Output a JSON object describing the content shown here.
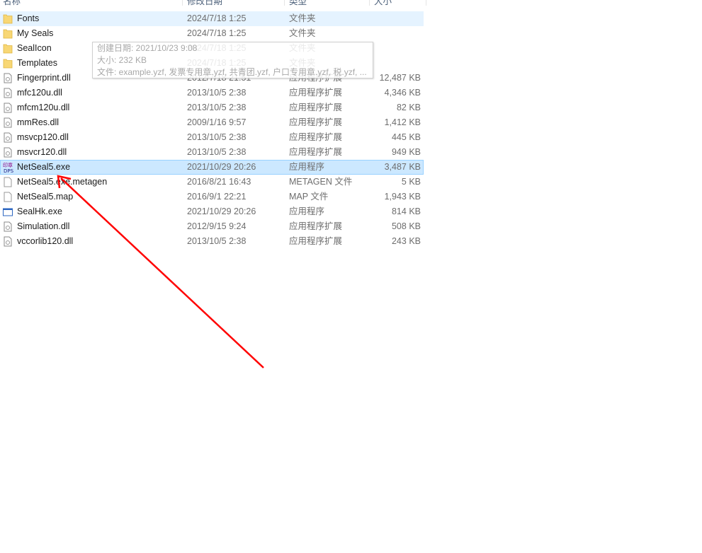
{
  "columns": {
    "name": "名称",
    "date": "修改日期",
    "type": "类型",
    "size": "大小"
  },
  "files": [
    {
      "name": "Fonts",
      "date": "2024/7/18 1:25",
      "type": "文件夹",
      "size": "",
      "icon": "folder-icon",
      "state": "hover"
    },
    {
      "name": "My Seals",
      "date": "2024/7/18 1:25",
      "type": "文件夹",
      "size": "",
      "icon": "folder-icon"
    },
    {
      "name": "SealIcon",
      "date": "2024/7/18 1:25",
      "type": "文件夹",
      "size": "",
      "icon": "folder-icon"
    },
    {
      "name": "Templates",
      "date": "2024/7/18 1:25",
      "type": "文件夹",
      "size": "",
      "icon": "folder-icon"
    },
    {
      "name": "Fingerprint.dll",
      "date": "2012/7/18 21:51",
      "type": "应用程序扩展",
      "size": "12,487 KB",
      "icon": "dll-icon"
    },
    {
      "name": "mfc120u.dll",
      "date": "2013/10/5 2:38",
      "type": "应用程序扩展",
      "size": "4,346 KB",
      "icon": "dll-icon"
    },
    {
      "name": "mfcm120u.dll",
      "date": "2013/10/5 2:38",
      "type": "应用程序扩展",
      "size": "82 KB",
      "icon": "dll-icon"
    },
    {
      "name": "mmRes.dll",
      "date": "2009/1/16 9:57",
      "type": "应用程序扩展",
      "size": "1,412 KB",
      "icon": "dll-icon"
    },
    {
      "name": "msvcp120.dll",
      "date": "2013/10/5 2:38",
      "type": "应用程序扩展",
      "size": "445 KB",
      "icon": "dll-icon"
    },
    {
      "name": "msvcr120.dll",
      "date": "2013/10/5 2:38",
      "type": "应用程序扩展",
      "size": "949 KB",
      "icon": "dll-icon"
    },
    {
      "name": "NetSeal5.exe",
      "date": "2021/10/29 20:26",
      "type": "应用程序",
      "size": "3,487 KB",
      "icon": "netseal-app-icon",
      "state": "selected"
    },
    {
      "name": "NetSeal5.exe.metagen",
      "date": "2016/8/21 16:43",
      "type": "METAGEN 文件",
      "size": "5 KB",
      "icon": "file-icon"
    },
    {
      "name": "NetSeal5.map",
      "date": "2016/9/1 22:21",
      "type": "MAP 文件",
      "size": "1,943 KB",
      "icon": "file-icon"
    },
    {
      "name": "SealHk.exe",
      "date": "2021/10/29 20:26",
      "type": "应用程序",
      "size": "814 KB",
      "icon": "exe-window-icon"
    },
    {
      "name": "Simulation.dll",
      "date": "2012/9/15 9:24",
      "type": "应用程序扩展",
      "size": "508 KB",
      "icon": "dll-icon"
    },
    {
      "name": "vccorlib120.dll",
      "date": "2013/10/5 2:38",
      "type": "应用程序扩展",
      "size": "243 KB",
      "icon": "dll-icon"
    }
  ],
  "tooltip": {
    "created": "创建日期: 2021/10/23 9:08",
    "size": "大小: 232 KB",
    "files": "文件: example.yzf, 发票专用章.yzf, 共青团.yzf, 户口专用章.yzf, 税.yzf, ..."
  },
  "annotation": {
    "color": "#ff0000"
  }
}
